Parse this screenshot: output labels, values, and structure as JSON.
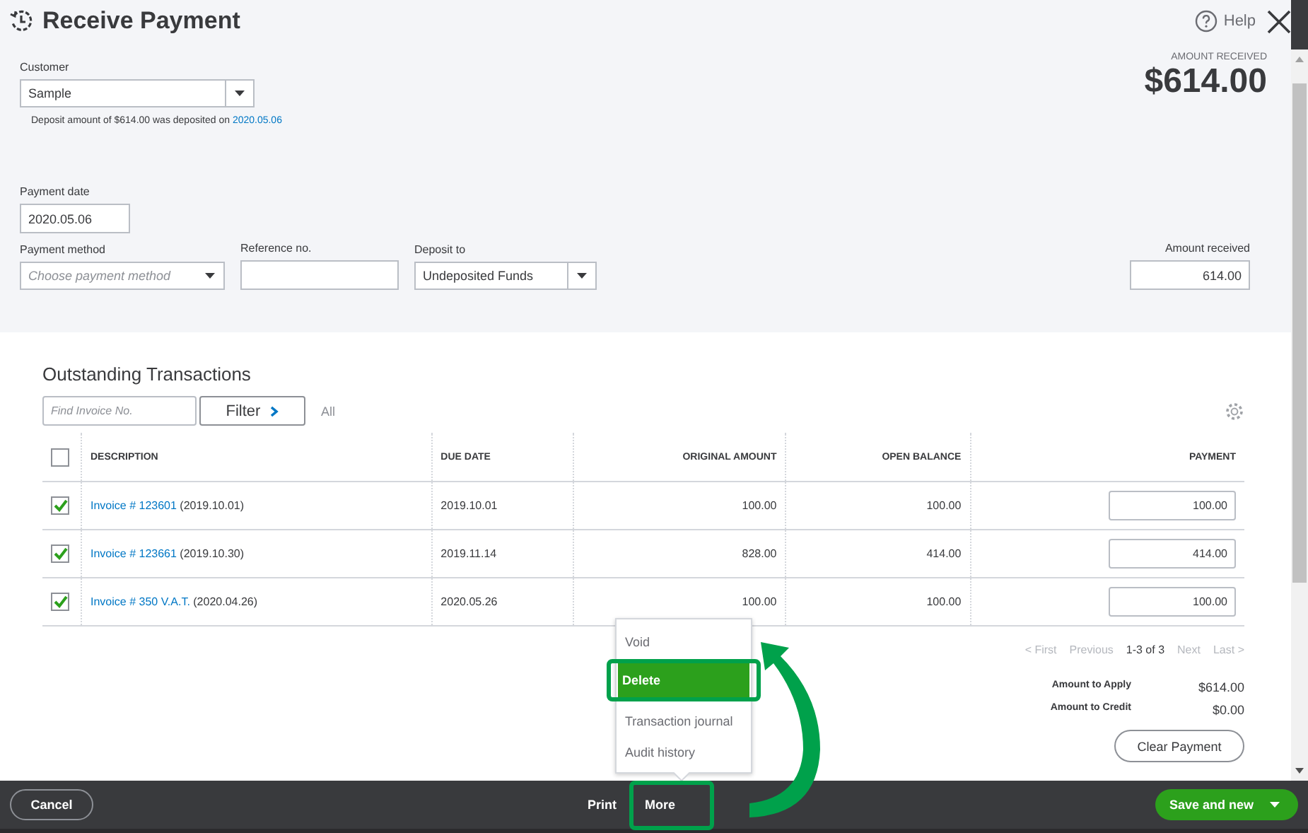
{
  "header": {
    "title": "Receive Payment",
    "help": "Help"
  },
  "customer": {
    "label": "Customer",
    "value": "Sample",
    "note": "Deposit amount of $614.00 was deposited on",
    "note_link": "2020.05.06"
  },
  "amount_summary": {
    "label": "AMOUNT RECEIVED",
    "value": "$614.00"
  },
  "payment_date": {
    "label": "Payment date",
    "value": "2020.05.06"
  },
  "payment_method": {
    "label": "Payment method",
    "placeholder": "Choose payment method"
  },
  "reference": {
    "label": "Reference no."
  },
  "deposit_to": {
    "label": "Deposit to",
    "value": "Undeposited Funds"
  },
  "amount_received": {
    "label": "Amount received",
    "value": "614.00"
  },
  "transactions": {
    "title": "Outstanding Transactions",
    "search_placeholder": "Find Invoice No.",
    "filter": "Filter",
    "filter_value": "All",
    "select_all_checked": false,
    "columns": [
      "DESCRIPTION",
      "DUE DATE",
      "ORIGINAL AMOUNT",
      "OPEN BALANCE",
      "PAYMENT"
    ],
    "rows": [
      {
        "checked": true,
        "invoice": "Invoice # 123601",
        "date": "(2019.10.01)",
        "due_date": "2019.10.01",
        "original_amount": "100.00",
        "open_balance": "100.00",
        "payment": "100.00"
      },
      {
        "checked": true,
        "invoice": "Invoice # 123661",
        "date": "(2019.10.30)",
        "due_date": "2019.11.14",
        "original_amount": "828.00",
        "open_balance": "414.00",
        "payment": "414.00"
      },
      {
        "checked": true,
        "invoice": "Invoice # 350 V.A.T.",
        "date": "(2020.04.26)",
        "due_date": "2020.05.26",
        "original_amount": "100.00",
        "open_balance": "100.00",
        "payment": "100.00"
      }
    ],
    "pager": {
      "first": "< First",
      "previous": "Previous",
      "range": "1-3 of 3",
      "next": "Next",
      "last": "Last >"
    },
    "totals": [
      {
        "label": "Amount to Apply",
        "value": "$614.00"
      },
      {
        "label": "Amount to Credit",
        "value": "$0.00"
      }
    ],
    "clear_button": "Clear Payment"
  },
  "more_menu": {
    "items": [
      {
        "label": "Void",
        "selected": false
      },
      {
        "label": "Delete",
        "selected": true
      },
      {
        "label": "Transaction journal",
        "selected": false
      },
      {
        "label": "Audit history",
        "selected": false
      }
    ]
  },
  "footer": {
    "cancel": "Cancel",
    "print": "Print",
    "more": "More",
    "save": "Save and new"
  }
}
